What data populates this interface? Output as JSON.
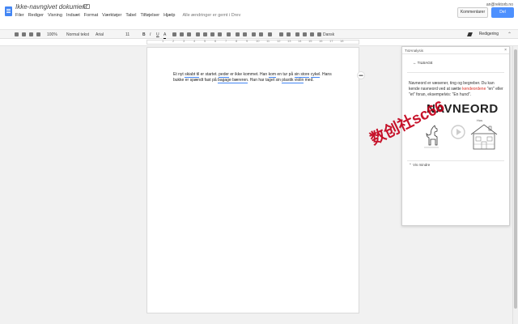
{
  "header": {
    "title": "Ikke-navngivet dokument",
    "email": "an@rektorb.no",
    "comments_label": "Kommentarer",
    "share_label": "Del"
  },
  "menu": {
    "items": [
      "Filer",
      "Rediger",
      "Visning",
      "Indsæt",
      "Format",
      "Værktøjer",
      "Tabel",
      "Tilføjelser",
      "Hjælp"
    ],
    "status": "Alle ændringer er gemt i Drev"
  },
  "toolbar": {
    "zoom": "100%",
    "style": "Normal tekst",
    "font": "Arial",
    "size": "11",
    "voice": "Dansk",
    "mode": "Redigering"
  },
  "ruler": {
    "numbers": [
      "1",
      "2",
      "3",
      "4",
      "5",
      "6",
      "7",
      "8",
      "9",
      "10",
      "11",
      "12",
      "13",
      "14",
      "15",
      "16",
      "17",
      "18"
    ]
  },
  "document": {
    "seg1": "Et nyt ",
    "w1": "skiabt til",
    "seg2": " er startet. ",
    "w2": "peder",
    "seg3": " er ikke kommet. Han ",
    "w3": "kom",
    "seg4": " en tur på ",
    "w4": "sin store",
    "seg5": " ",
    "w5": "cykel",
    "seg6": ". Hans bukke er spændt fast på ",
    "w6": "bagage bæreren",
    "seg7": ". Han har taget sin ",
    "w7": "plastik violin",
    "seg8": " med."
  },
  "panel": {
    "title": "TxtAnalysis",
    "back_label": "TILBAGE",
    "desc1": "Navneord er væsener, ting og begreber. Du kan kende navneord ved at sætte ",
    "desc_red": "kendeordene",
    "desc2": " \"en\" eller \"et\" foran, eksempelvis: \"En hund\".",
    "term": "NAVNEORD",
    "example": "Hus",
    "show_less": "Vis mindre"
  },
  "watermark": "数创社sc66"
}
